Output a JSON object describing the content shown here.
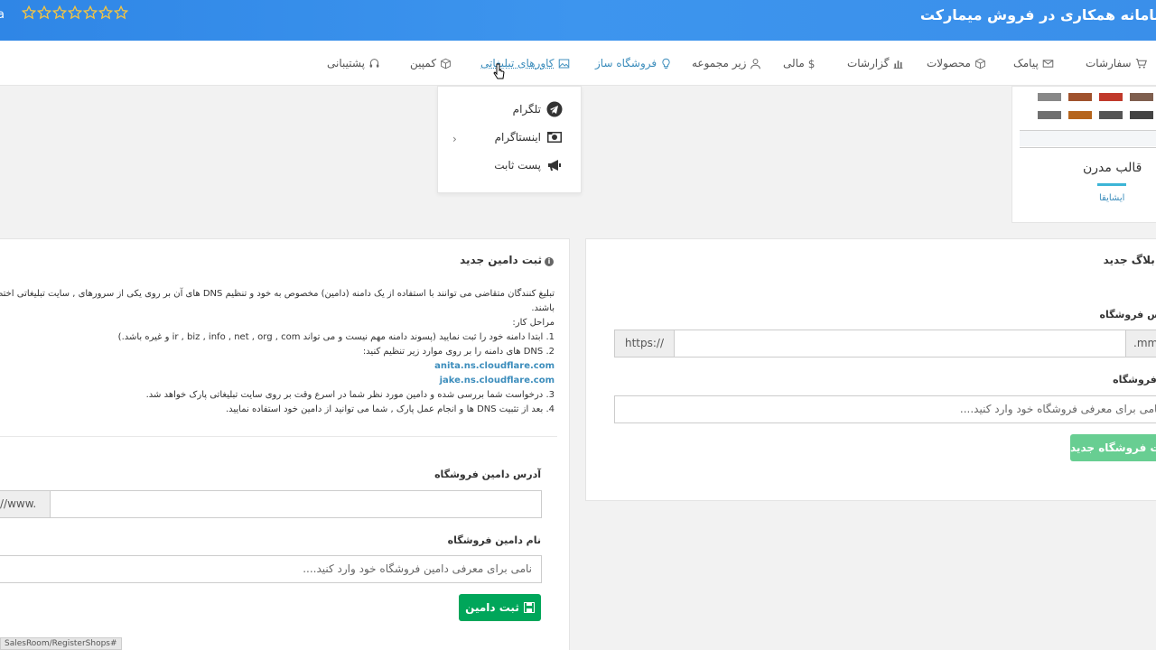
{
  "banner": {
    "title": "سامانه همکاری در فروش میمارکت",
    "rating": {
      "value": 0,
      "max": 7
    },
    "left_fragment": "a"
  },
  "nav": {
    "items": [
      {
        "label": "سفارشات",
        "icon": "cart-icon"
      },
      {
        "label": "پیامک",
        "icon": "envelope-icon"
      },
      {
        "label": "محصولات",
        "icon": "cube-icon"
      },
      {
        "label": "گزارشات",
        "icon": "bar-chart-icon"
      },
      {
        "label": "مالی",
        "icon": "dollar-icon"
      },
      {
        "label": "زیر مجموعه",
        "icon": "user-icon"
      },
      {
        "label": "فروشگاه ساز",
        "icon": "lightbulb-icon"
      },
      {
        "label": "کاورهای تبلیغاتی",
        "icon": "image-icon"
      },
      {
        "label": "کمپین",
        "icon": "cube-icon"
      },
      {
        "label": "پشتیبانی",
        "icon": "headset-icon"
      }
    ],
    "active_index": 7
  },
  "dropdown": {
    "items": [
      {
        "label": "تلگرام",
        "icon": "telegram-icon"
      },
      {
        "label": "اینستاگرام",
        "icon": "camera-icon"
      },
      {
        "label": "پست ثابت",
        "icon": "megaphone-icon"
      }
    ],
    "chevron": "›"
  },
  "template_card": {
    "title": "قالب مدرن",
    "link": "ایشایقا"
  },
  "domain_panel": {
    "title": "ثبت دامین جدید",
    "desc_line1": "تبلیغ کنندگان متقاضی می توانند با استفاده از یک دامنه (دامین) مخصوص به خود و تنظیم DNS های آن بر روی یکی از سرورهای , سایت تبلیغاتی اختصاصی",
    "desc_line2": "باشند.",
    "steps_title": "مراحل کار:",
    "step1": "1. ابتدا دامنه خود را ثبت نمایید (پسوند دامنه مهم نیست و می تواند ir , biz , info , net , org , com و غیره باشد.)",
    "step2": "2. DNS های دامنه را بر روی موارد زیر تنظیم کنید:",
    "ns1": "anita.ns.cloudflare.com",
    "ns2": "jake.ns.cloudflare.com",
    "step3": "3. درخواست شما بررسی شده و دامین مورد نظر شما در اسرع وقت بر روی سایت تبلیغاتی پارک خواهد شد.",
    "step4": "4. بعد از تثبیت DNS ها و انجام عمل پارک , شما می توانید از دامین خود استفاده نمایید.",
    "address_label": "آدرس دامین فروشگاه",
    "address_prefix": "//www.",
    "address_value": "",
    "name_label": "نام دامین فروشگاه",
    "name_placeholder": "نامی برای معرفی دامین فروشگاه خود وارد کنید....",
    "submit": "ثبت دامین"
  },
  "store_panel": {
    "title": "ثبت بلاگ جدید",
    "address_label": "آدرس فروشگاه",
    "address_prefix": "https://",
    "address_suffix": ".mm",
    "name_label": "نام فروشگاه",
    "name_placeholder": "نامی برای معرفی فروشگاه خود وارد کنید....",
    "submit": "ثبت فروشگاه جدید"
  },
  "status_url": "SalesRoom/RegisterShops#"
}
